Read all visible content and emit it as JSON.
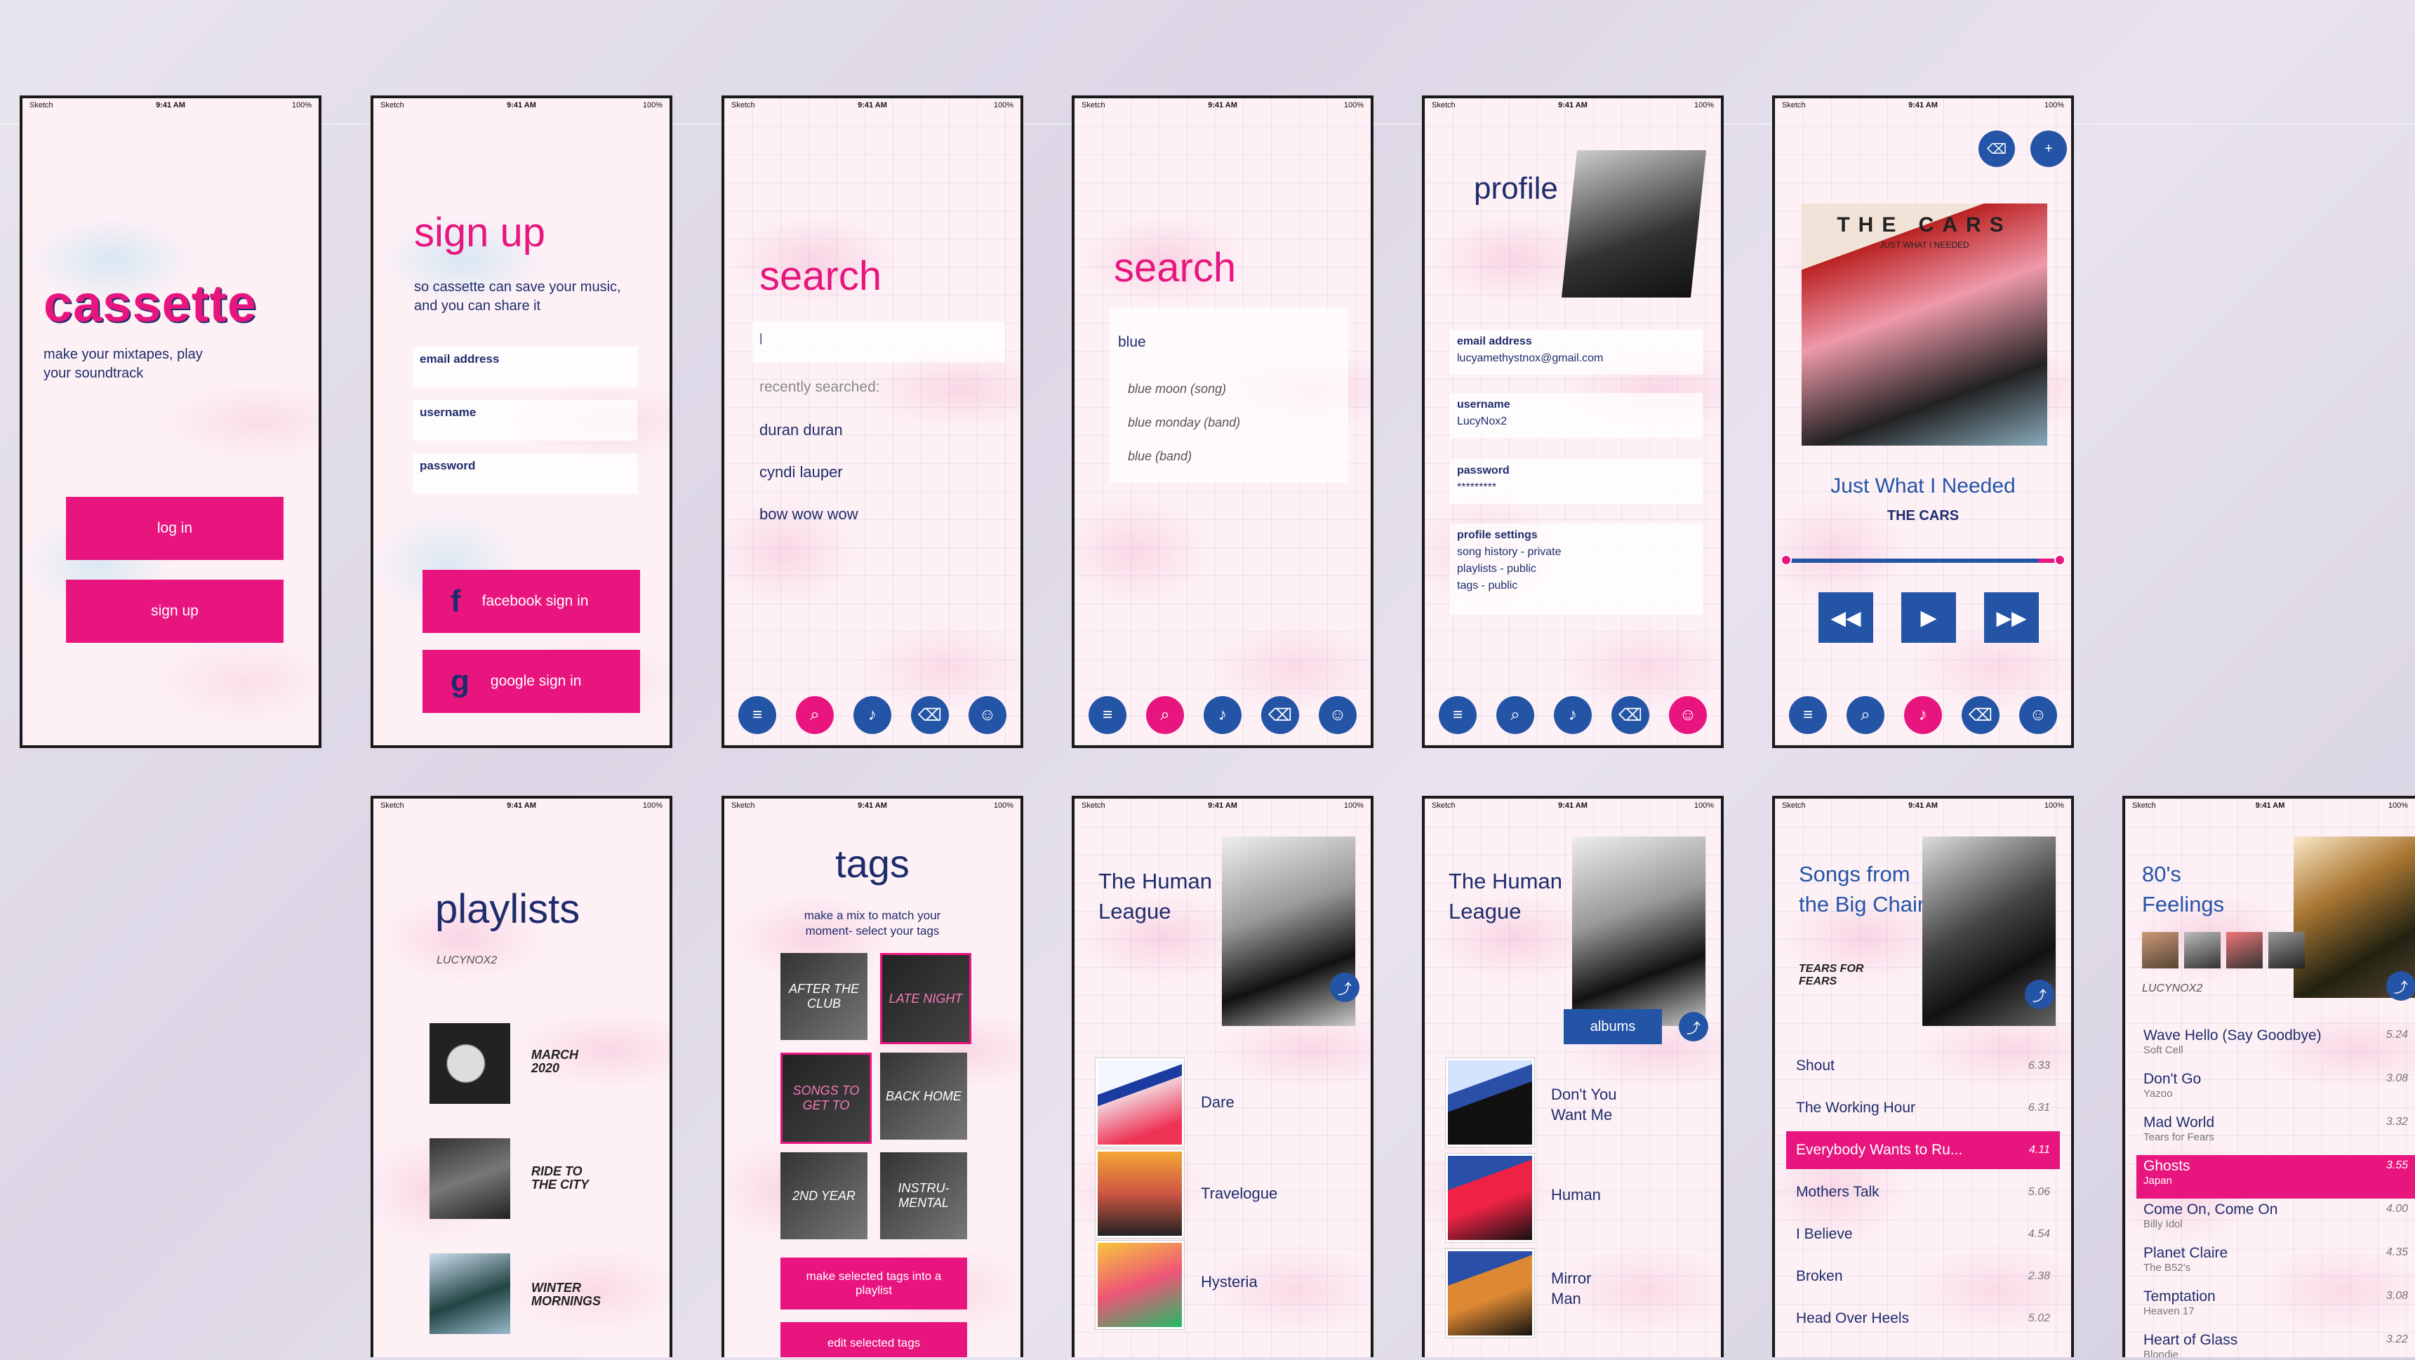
{
  "status": {
    "carrier": "Sketch",
    "time": "9:41 AM",
    "battery": "100%"
  },
  "landing": {
    "logo": "cassette",
    "tagline": "make your mixtapes, play your soundtrack",
    "login": "log in",
    "signup": "sign up"
  },
  "signup": {
    "title": "sign up",
    "subtitle": "so cassette can save your music, and you can share it",
    "email": "email address",
    "username": "username",
    "password": "password",
    "facebook": "facebook sign in",
    "google": "google sign in",
    "f_letter": "f",
    "g_letter": "g"
  },
  "search_empty": {
    "title": "search",
    "cursor": "|",
    "recent_label": "recently searched:",
    "recent": [
      "duran duran",
      "cyndi lauper",
      "bow wow wow"
    ]
  },
  "search_blue": {
    "title": "search",
    "query": "blue",
    "suggestions": [
      "blue moon (song)",
      "blue monday (band)",
      "blue (band)"
    ]
  },
  "profile": {
    "title": "profile",
    "email_label": "email address",
    "email": "lucyamethystnox@gmail.com",
    "username_label": "username",
    "username": "LucyNox2",
    "password_label": "password",
    "password": "*********",
    "settings_label": "profile settings",
    "settings": [
      "song history - private",
      "playlists - public",
      "tags - public"
    ]
  },
  "player": {
    "album_band": "THE CARS",
    "album_sub": "JUST WHAT I NEEDED",
    "song": "Just What I Needed",
    "artist": "THE CARS",
    "progress": 0.92
  },
  "nav": {
    "icons": [
      "list-icon",
      "search-icon",
      "music-note-icon",
      "tag-icon",
      "profile-icon"
    ]
  },
  "playlists": {
    "title": "playlists",
    "user": "LUCYNOX2",
    "items": [
      {
        "name": "MARCH 2020"
      },
      {
        "name": "RIDE TO THE CITY"
      },
      {
        "name": "WINTER MORNINGS"
      }
    ]
  },
  "tags": {
    "title": "tags",
    "subtitle": "make a mix to match your moment- select your tags",
    "items": [
      "AFTER THE CLUB",
      "LATE NIGHT",
      "SONGS TO GET TO",
      "BACK HOME",
      "2ND YEAR",
      "INSTRU-MENTAL"
    ],
    "make_btn": "make selected tags into a playlist",
    "edit_btn": "edit selected tags"
  },
  "artist1": {
    "title": "The Human League",
    "albums": [
      "Dare",
      "Travelogue",
      "Hysteria"
    ]
  },
  "artist2": {
    "title": "The Human League",
    "albums_btn": "albums",
    "albums": [
      "Don't You Want Me",
      "Human",
      "Mirror Man"
    ]
  },
  "album": {
    "title": "Songs from the Big Chair",
    "artist": "TEARS FOR FEARS",
    "tracks": [
      {
        "name": "Shout",
        "dur": "6.33"
      },
      {
        "name": "The Working Hour",
        "dur": "6.31"
      },
      {
        "name": "Everybody Wants to Ru...",
        "dur": "4.11"
      },
      {
        "name": "Mothers Talk",
        "dur": "5.06"
      },
      {
        "name": "I Believe",
        "dur": "4.54"
      },
      {
        "name": "Broken",
        "dur": "2.38"
      },
      {
        "name": "Head Over Heels",
        "dur": "5.02"
      }
    ]
  },
  "feelings": {
    "title": "80's Feelings",
    "user": "LUCYNOX2",
    "tracks": [
      {
        "name": "Wave Hello (Say Goodbye)",
        "artist": "Soft Cell",
        "dur": "5.24"
      },
      {
        "name": "Don't Go",
        "artist": "Yazoo",
        "dur": "3.08"
      },
      {
        "name": "Mad World",
        "artist": "Tears for Fears",
        "dur": "3.32"
      },
      {
        "name": "Ghosts",
        "artist": "Japan",
        "dur": "3.55"
      },
      {
        "name": "Come On, Come On",
        "artist": "Billy Idol",
        "dur": "4.00"
      },
      {
        "name": "Planet Claire",
        "artist": "The B52's",
        "dur": "4.35"
      },
      {
        "name": "Temptation",
        "artist": "Heaven 17",
        "dur": "3.08"
      },
      {
        "name": "Heart of Glass",
        "artist": "Blondie",
        "dur": "3.22"
      }
    ]
  }
}
